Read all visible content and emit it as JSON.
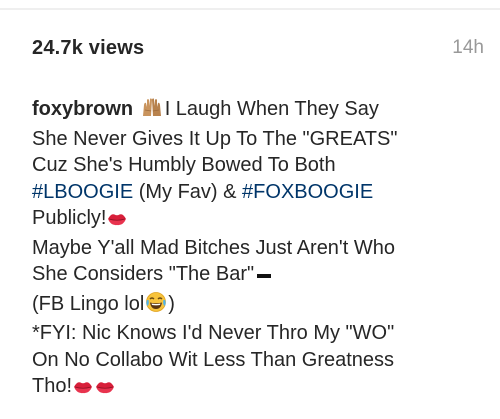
{
  "post": {
    "views": "24.7k views",
    "time_ago": "14h"
  },
  "caption": {
    "username": "foxybrown",
    "line1_text": "I Laugh When They Say",
    "line2": "She Never Gives It Up To The \"GREATS\"",
    "line3": "Cuz She's Humbly Bowed To Both",
    "line4_hashtag1": "#LBOOGIE",
    "line4_mid": " (My Fav) & ",
    "line4_hashtag2": "#FOXBOOGIE",
    "line5": "Publicly!",
    "line6": "Maybe Y'all Mad Bitches Just Aren't Who",
    "line7": "She Considers \"The Bar\"",
    "line8_pre": "(FB Lingo lol",
    "line8_post": ")",
    "line9": "*FYI: Nic Knows I'd Never Thro My \"WO\"",
    "line10": "On No Collabo Wit Less Than Greatness",
    "line11": "Tho!"
  },
  "emojis": {
    "raised_hands": "raised-hands-icon",
    "kiss_lips": "kiss-lips-icon",
    "minus": "heavy-minus-icon",
    "laughing": "tears-of-joy-icon"
  },
  "colors": {
    "text": "#262626",
    "muted": "#999999",
    "hashtag": "#003569"
  }
}
